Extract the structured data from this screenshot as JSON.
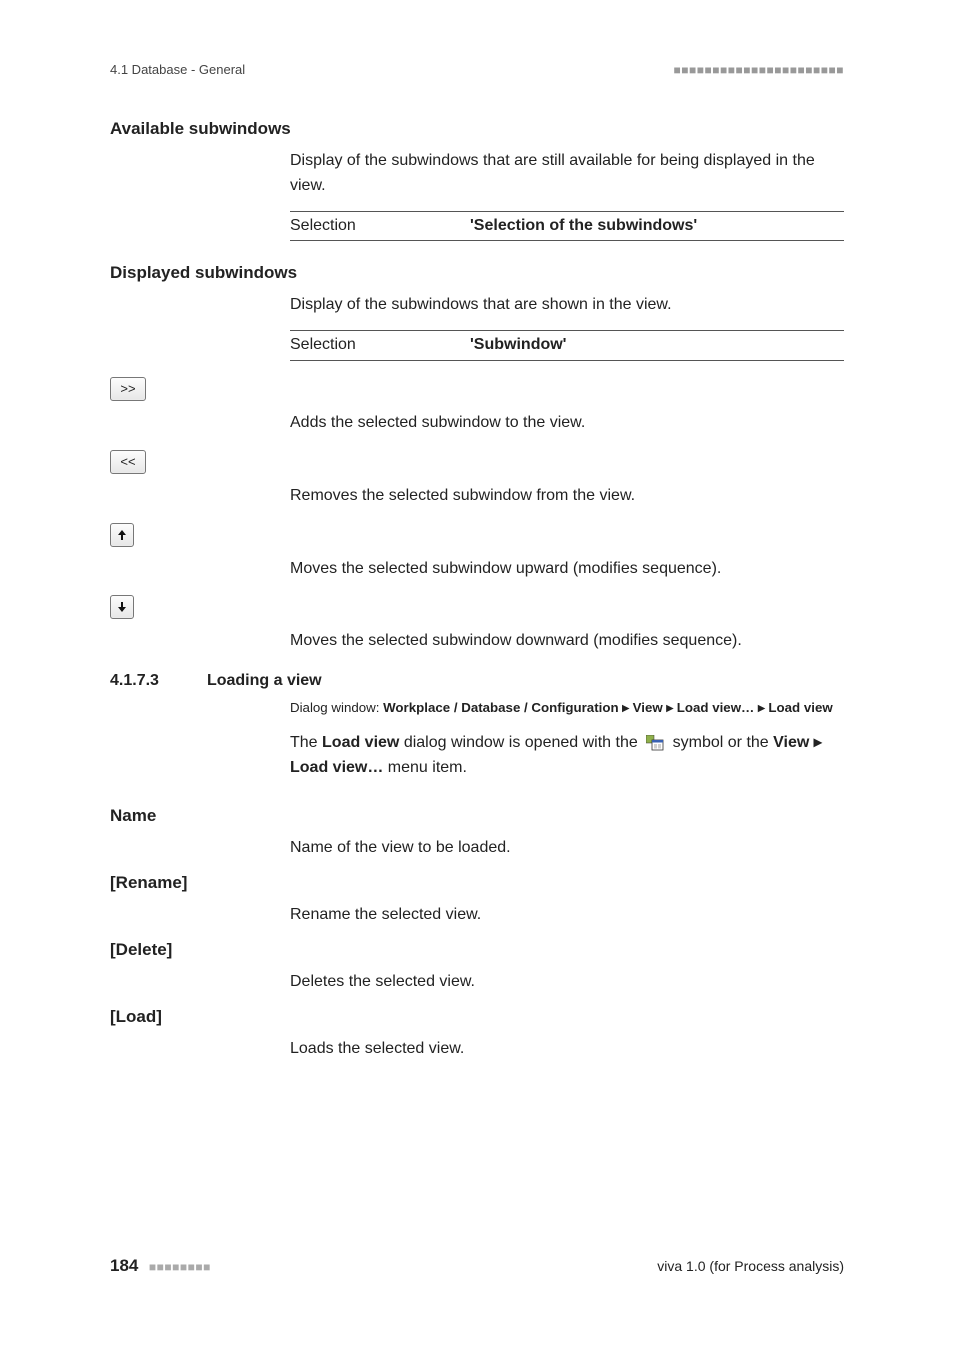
{
  "header": {
    "left": "4.1 Database - General",
    "right_dashes": "■■■■■■■■■■■■■■■■■■■■■■"
  },
  "sections": {
    "available": {
      "title": "Available subwindows",
      "desc": "Display of the subwindows that are still available for being displayed in the view.",
      "sel_key": "Selection",
      "sel_val": "'Selection of the subwindows'"
    },
    "displayed": {
      "title": "Displayed subwindows",
      "desc": "Display of the subwindows that are shown in the view.",
      "sel_key": "Selection",
      "sel_val": "'Subwindow'"
    },
    "buttons": {
      "add_label": ">>",
      "add_desc": "Adds the selected subwindow to the view.",
      "remove_label": "<<",
      "remove_desc": "Removes the selected subwindow from the view.",
      "up_desc": "Moves the selected subwindow upward (modifies sequence).",
      "down_desc": "Moves the selected subwindow downward (modifies sequence)."
    },
    "loading": {
      "number": "4.1.7.3",
      "title": "Loading a view",
      "dialog_prefix": "Dialog window: ",
      "dialog_bold": "Workplace / Database / Configuration ▸ View ▸ Load view… ▸ Load view",
      "p1_a": "The ",
      "p1_b": "Load view",
      "p1_c": " dialog window is opened with the ",
      "p1_d": " symbol or the ",
      "p1_e": "View ▸ Load view…",
      "p1_f": " menu item."
    },
    "name": {
      "title": "Name",
      "desc": "Name of the view to be loaded."
    },
    "rename": {
      "title": "[Rename]",
      "desc": "Rename the selected view."
    },
    "delete": {
      "title": "[Delete]",
      "desc": "Deletes the selected view."
    },
    "load": {
      "title": "[Load]",
      "desc": "Loads the selected view."
    }
  },
  "footer": {
    "page": "184",
    "dashes": "■■■■■■■■",
    "version": "viva 1.0 (for Process analysis)"
  }
}
